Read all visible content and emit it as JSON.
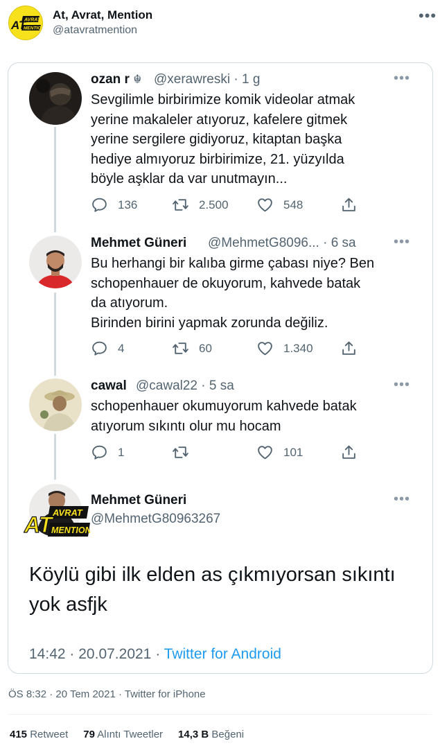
{
  "account": {
    "name": "At, Avrat, Mention",
    "handle": "@atavratmention",
    "logo_text_top": "AVRAT",
    "logo_text_left": "AT",
    "logo_text_bottom": "MENTION"
  },
  "thread": [
    {
      "name": "ozan r",
      "name_glyph": "☬",
      "handle": "@xerawreski",
      "sep": "·",
      "time": "1 g",
      "text_lines": [
        "Sevgilimle birbirimize komik videolar atmak",
        "yerine makaleler atıyoruz, kafelere gitmek",
        "yerine sergilere gidiyoruz, kitaptan başka",
        "hediye almıyoruz birbirimize, 21. yüzyılda",
        "böyle aşklar da var unutmayın..."
      ],
      "replies": "136",
      "retweets": "2.500",
      "likes": "548"
    },
    {
      "name": "Mehmet Güneri",
      "handle": "@MehmetG8096...",
      "sep": "·",
      "time": "6 sa",
      "text_lines": [
        "Bu herhangi bir kalıba girme çabası niye? Ben",
        "schopenhauer de okuyorum, kahvede batak",
        "da atıyorum.",
        "Birinden birini yapmak zorunda değiliz."
      ],
      "replies": "4",
      "retweets": "60",
      "likes": "1.340"
    },
    {
      "name": "cawal",
      "handle": "@cawal22",
      "sep": "·",
      "time": "5 sa",
      "text_lines": [
        "schopenhauer okumuyorum kahvede batak",
        "atıyorum sıkıntı olur mu hocam"
      ],
      "replies": "1",
      "retweets": "",
      "likes": "101"
    }
  ],
  "main_tweet": {
    "name": "Mehmet Güneri",
    "handle": "@MehmetG80963267",
    "text_lines": [
      "Köylü gibi ilk elden as çıkmıyorsan sıkıntı",
      "yok asfjk"
    ],
    "time": "14:42",
    "sep": "·",
    "date": "20.07.2021",
    "source": "Twitter for Android"
  },
  "footer": {
    "meta": "ÖS 8:32 · 20 Tem 2021 · Twitter for iPhone",
    "retweets_count": "415",
    "retweets_label": "Retweet",
    "quotes_count": "79",
    "quotes_label": "Alıntı Tweetler",
    "likes_count": "14,3 B",
    "likes_label": "Beğeni"
  },
  "icons": {
    "reply": "reply-icon",
    "retweet": "retweet-icon",
    "like": "heart-icon",
    "share": "share-icon",
    "more": "more-icon"
  },
  "colors": {
    "text": "#0f1419",
    "secondary": "#536471",
    "link": "#1d9bf0",
    "border": "#cfd9de",
    "logo_yellow": "#f7e01c"
  }
}
